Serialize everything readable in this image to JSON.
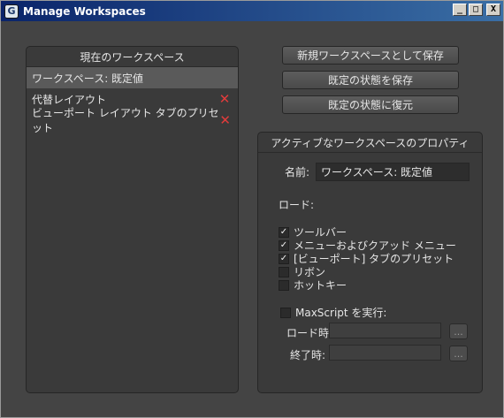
{
  "window": {
    "title": "Manage Workspaces",
    "app_icon_glyph": "G",
    "minimize_glyph": "_",
    "maximize_glyph": "□",
    "close_glyph": "X"
  },
  "workspaces": {
    "header": "現在のワークスペース",
    "items": [
      {
        "label": "ワークスペース: 既定値",
        "selected": true,
        "deletable": false
      },
      {
        "label": "代替レイアウト",
        "selected": false,
        "deletable": true
      },
      {
        "label": "ビューポート レイアウト タブのプリセット",
        "selected": false,
        "deletable": true
      }
    ],
    "delete_glyph": "✕"
  },
  "actions": {
    "save_new": "新規ワークスペースとして保存",
    "save_default": "既定の状態を保存",
    "restore_default": "既定の状態に復元"
  },
  "properties": {
    "header": "アクティブなワークスペースのプロパティ",
    "name_label": "名前:",
    "name_value": "ワークスペース: 既定値",
    "load_label": "ロード:",
    "checkboxes": [
      {
        "label": "ツールバー",
        "checked": true
      },
      {
        "label": "メニューおよびクアッド メニュー",
        "checked": true
      },
      {
        "label": "[ビューポート] タブのプリセット",
        "checked": true
      },
      {
        "label": "リボン",
        "checked": false
      },
      {
        "label": "ホットキー",
        "checked": false
      }
    ],
    "maxscript_label": "MaxScript を実行:",
    "maxscript_checked": false,
    "on_load_label": "ロード時:",
    "on_exit_label": "終了時:",
    "browse_glyph": "..."
  },
  "colors": {
    "background": "#444444",
    "panel": "#3a3a3a",
    "selected": "#5a5a5a",
    "delete": "#e23b3b",
    "titlebar_start": "#0a246a",
    "titlebar_end": "#3a6ea5"
  }
}
